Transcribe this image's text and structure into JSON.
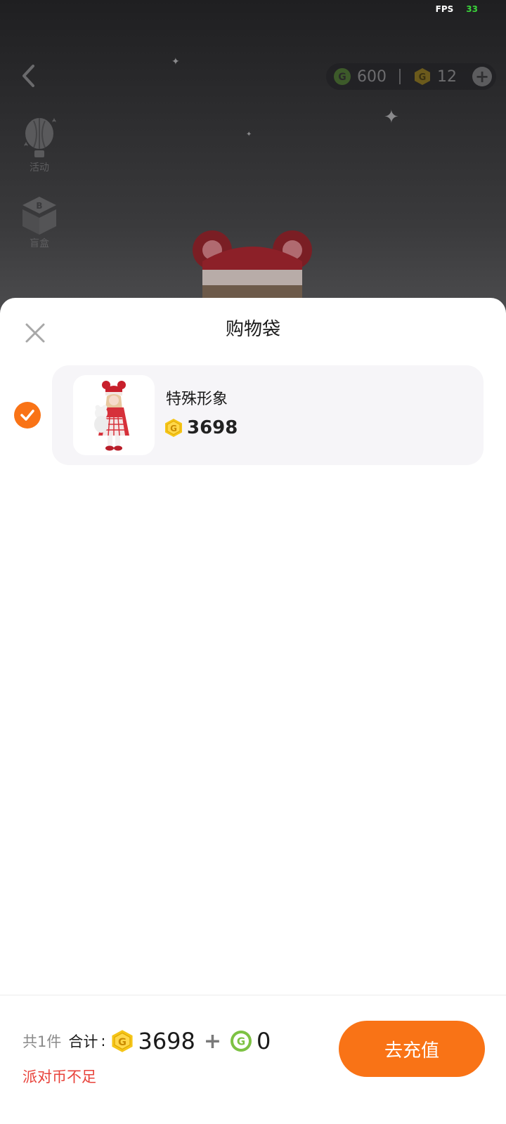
{
  "status": {
    "fps_label": "FPS",
    "fps_value": "33"
  },
  "top_bar": {
    "green_coin_amount": "600",
    "gold_coin_amount": "12"
  },
  "side_menu": {
    "activity_label": "活动",
    "blind_box_label": "盲盒"
  },
  "sheet": {
    "title": "购物袋",
    "item": {
      "name": "特殊形象",
      "price": "3698",
      "selected": true
    }
  },
  "footer": {
    "count_text": "共1件",
    "total_label": "合计",
    "total_colon": ":",
    "gold_total": "3698",
    "plus": "+",
    "green_total": "0",
    "warning": "派对币不足",
    "recharge_label": "去充值"
  },
  "colors": {
    "accent": "#f97316",
    "warning": "#e8423a",
    "gold_coin": "#f5c518",
    "green_coin": "#7dc243"
  }
}
